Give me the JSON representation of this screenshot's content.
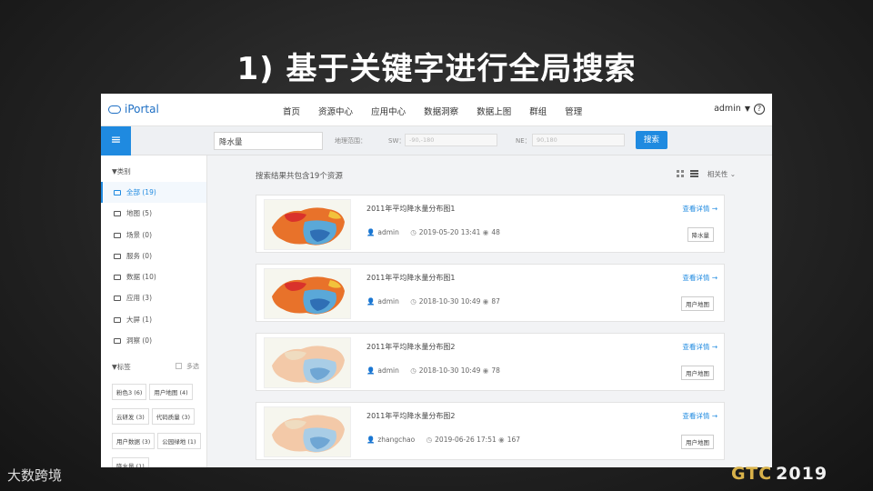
{
  "slide_title": "1) 基于关键字进行全局搜索",
  "app": {
    "logo_text": "iPortal"
  },
  "nav": [
    "首页",
    "资源中心",
    "应用中心",
    "数据洞察",
    "数据上图",
    "群组",
    "管理"
  ],
  "user": {
    "name": "admin",
    "caret": "▼",
    "help": "?"
  },
  "search": {
    "menu_glyph": "≡",
    "keyword": "降水量",
    "geo_label": "地理范围：",
    "sw_label": "SW：",
    "sw_placeholder": "-90,-180",
    "ne_label": "NE：",
    "ne_placeholder": "90,180",
    "button": "搜索"
  },
  "sidebar": {
    "category_header": "▼类别",
    "categories": [
      {
        "label": "全部 (19)"
      },
      {
        "label": "地图 (5)"
      },
      {
        "label": "场景 (0)"
      },
      {
        "label": "服务 (0)"
      },
      {
        "label": "数据 (10)"
      },
      {
        "label": "应用 (3)"
      },
      {
        "label": "大屏 (1)"
      },
      {
        "label": "洞察 (0)"
      }
    ],
    "tags_header": "▼标签",
    "multi_select": "多选",
    "tags": [
      "粉色3 (6)",
      "用户地图 (4)",
      "云研发 (3)",
      "代码质量 (3)",
      "用户数据 (3)",
      "公园绿地 (1)",
      "降水量 (1)"
    ]
  },
  "results": {
    "summary": "搜索结果共包含19个资源",
    "sort_label": "相关性 ⌄",
    "items": [
      {
        "title": "2011年平均降水量分布图1",
        "user": "admin",
        "date": "2019-05-20 13:41",
        "views": "48",
        "tag": "降水量",
        "detail": "查看详情 →"
      },
      {
        "title": "2011年平均降水量分布图1",
        "user": "admin",
        "date": "2018-10-30 10:49",
        "views": "87",
        "tag": "用户地图",
        "detail": "查看详情 →"
      },
      {
        "title": "2011年平均降水量分布图2",
        "user": "admin",
        "date": "2018-10-30 10:49",
        "views": "78",
        "tag": "用户地图",
        "detail": "查看详情 →"
      },
      {
        "title": "2011年平均降水量分布图2",
        "user": "zhangchao",
        "date": "2019-06-26 17:51",
        "views": "167",
        "tag": "用户地图",
        "detail": "查看详情 →"
      }
    ]
  },
  "footer": {
    "left_mark": "大数跨境",
    "gtc": "GTC",
    "year": "2019"
  },
  "colors": {
    "accent": "#1f8ae0",
    "gtc_gold": "#d9b24a"
  }
}
